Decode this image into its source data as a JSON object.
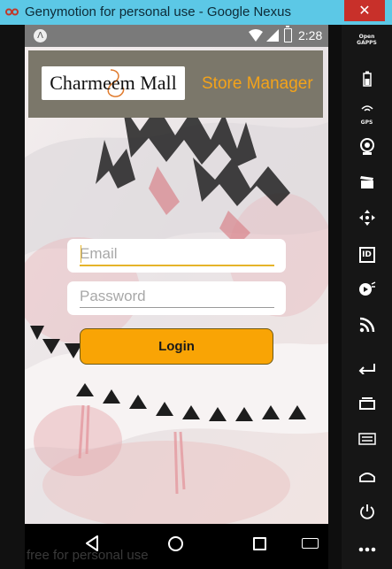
{
  "window": {
    "title": "Genymotion for personal use - Google Nexus",
    "close_glyph": "✕",
    "accent_color": "#5cc8e6"
  },
  "status_bar": {
    "app_glyph": "Λ",
    "time": "2:28",
    "icons": [
      "wifi-icon",
      "signal-icon",
      "battery-icon"
    ]
  },
  "header": {
    "logo_text": "Charmeem Mall",
    "title": "Store Manager",
    "title_color": "#f4a31a",
    "background_color": "#7b776a"
  },
  "login_form": {
    "email_placeholder": "Email",
    "password_placeholder": "Password",
    "login_label": "Login",
    "button_color": "#f9a405"
  },
  "nav_bar": {
    "buttons": [
      "back-icon",
      "home-icon",
      "recent-apps-icon",
      "keyboard-icon"
    ]
  },
  "watermark": "free for personal use",
  "toolbar": {
    "gapps_label": "Open\nGAPPS",
    "gps_label": "GPS",
    "id_label": "ID",
    "items": [
      "open-gapps-icon",
      "battery-icon",
      "gps-icon",
      "camera-icon",
      "video-icon",
      "move-icon",
      "id-icon",
      "media-icon",
      "rss-icon",
      "back-icon",
      "recent-apps-icon",
      "menu-icon",
      "home-icon",
      "power-icon",
      "more-icon"
    ]
  }
}
